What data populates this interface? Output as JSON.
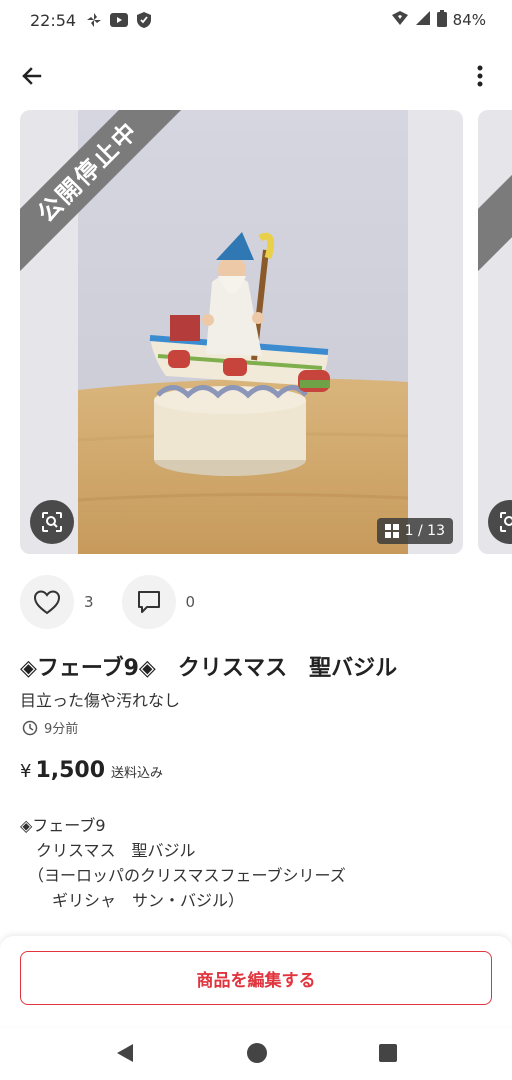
{
  "status_bar": {
    "time": "22:54",
    "battery": "84%",
    "left_icons": [
      "pinwheel-icon",
      "youtube-icon",
      "shield-icon"
    ],
    "right_icons": [
      "wifi-icon",
      "signal-icon",
      "battery-icon"
    ]
  },
  "app_bar": {
    "back_icon": "arrow-left-icon",
    "more_icon": "more-vertical-icon"
  },
  "gallery": {
    "ribbon_text": "公開停止中",
    "next_ribbon_text": "公",
    "counter": "1 / 13",
    "zoom_icon": "lens-search-icon",
    "grid_icon": "grid-icon"
  },
  "actions": {
    "like_count": "3",
    "comment_count": "0"
  },
  "item": {
    "title": "◈フェーブ9◈　クリスマス　聖バジル",
    "condition": "目立った傷や汚れなし",
    "time_ago": "9分前",
    "price_yen": "¥",
    "price": "1,500",
    "shipping": "送料込み",
    "description": "◈フェーブ9\n　クリスマス　聖バジル\n　（ヨーロッパのクリスマスフェーブシリーズ\n　　ギリシャ　サン・バジル）"
  },
  "edit_button": "商品を編集する",
  "colors": {
    "accent": "#e0353e",
    "ribbon": "#7b7b7b",
    "photo_bg": "#e6e6ea"
  },
  "nav_bar": {
    "icons": [
      "back-triangle-icon",
      "home-circle-icon",
      "recents-square-icon"
    ]
  }
}
